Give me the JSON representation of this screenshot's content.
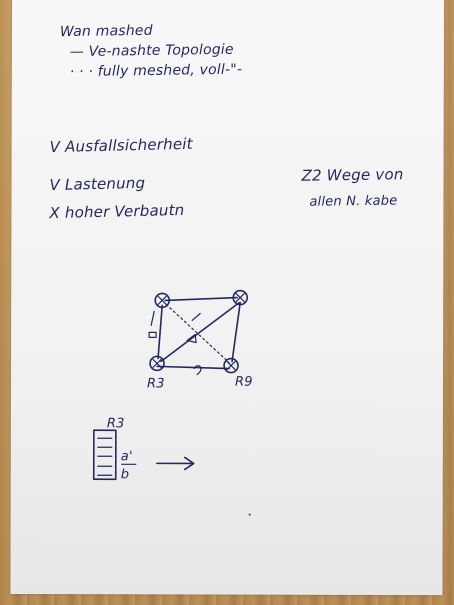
{
  "notes": {
    "line1": "Wan mashed",
    "line2": "— Ve-nashte Topologie",
    "line3": "· · · fully meshed, voll-\"-",
    "line4": "V Ausfallsicherheit",
    "line5": "V Lastenung",
    "line6": "X hoher Verbautn",
    "side1": "Z2 Wege von",
    "side2": "allen N. kabe"
  },
  "diagram": {
    "router_label_left": "R3",
    "router_label_right": "R9",
    "mini_label": "R3",
    "fraction_top": "a'",
    "fraction_bottom": "b"
  }
}
